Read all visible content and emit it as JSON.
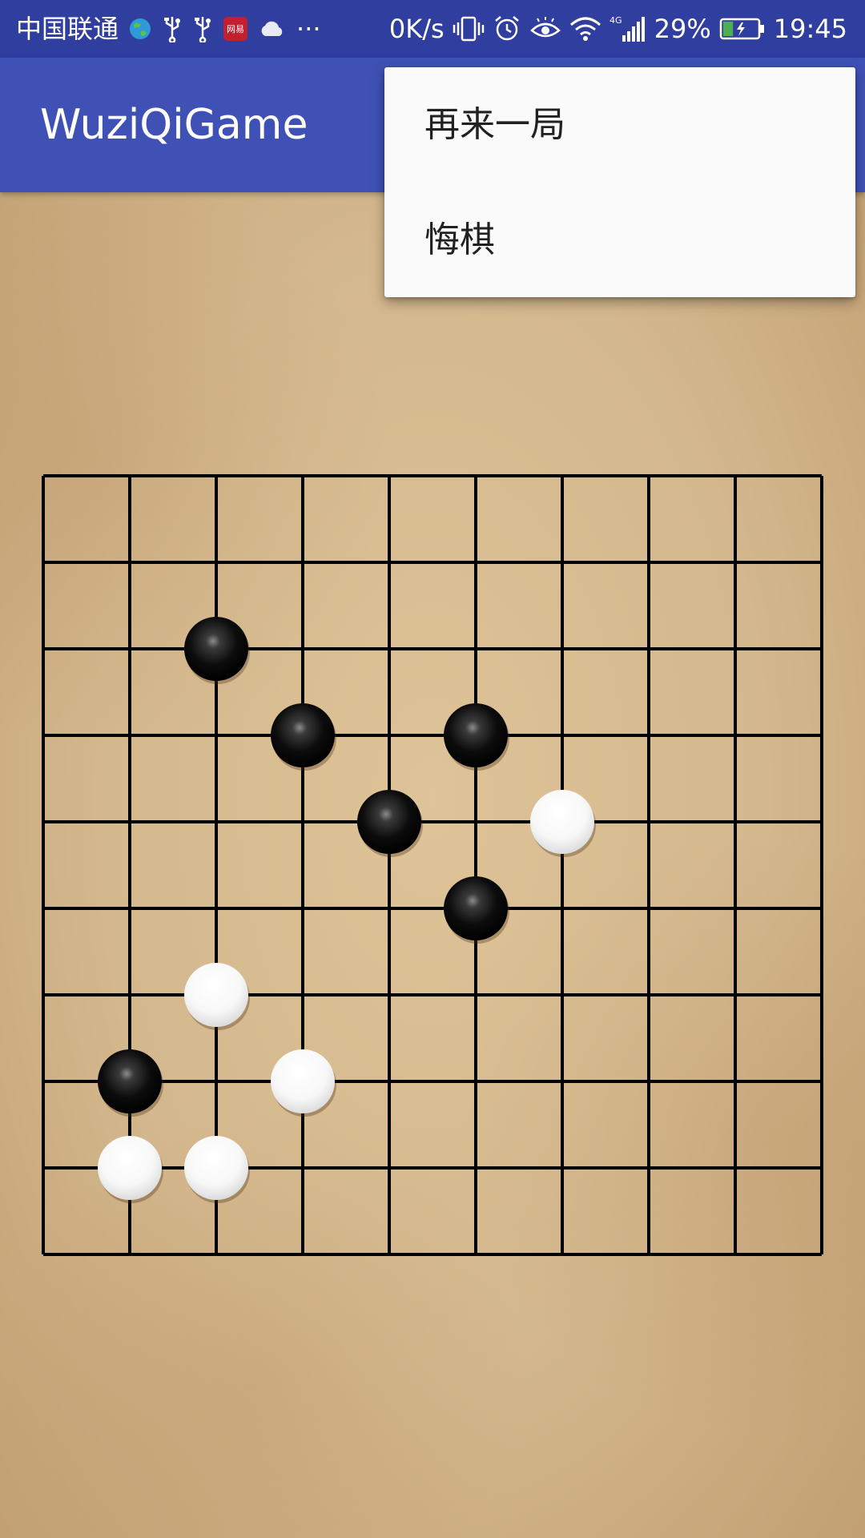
{
  "status_bar": {
    "carrier": "中国联通",
    "net_speed": "0K/s",
    "network_type": "4G",
    "battery_percent": "29%",
    "battery_level": 0.29,
    "time": "19:45",
    "more_dots": "···",
    "netease_badge": "网易",
    "icons_left": [
      "earth-icon",
      "usb-icon",
      "usb-icon",
      "netease-app-icon",
      "cloud-icon",
      "more-dots-icon"
    ],
    "icons_right": [
      "vibrate-icon",
      "alarm-icon",
      "eye-comfort-icon",
      "wifi-icon",
      "signal-icon",
      "battery-charging-icon"
    ]
  },
  "app_bar": {
    "title": "WuziQiGame"
  },
  "menu": {
    "items": [
      {
        "label": "再来一局"
      },
      {
        "label": "悔棋"
      }
    ]
  },
  "board": {
    "size": 10,
    "line_color": "#000000",
    "black_stones": [
      [
        2,
        2
      ],
      [
        3,
        3
      ],
      [
        5,
        3
      ],
      [
        4,
        4
      ],
      [
        5,
        5
      ],
      [
        1,
        7
      ]
    ],
    "white_stones": [
      [
        6,
        4
      ],
      [
        2,
        6
      ],
      [
        3,
        7
      ],
      [
        1,
        8
      ],
      [
        2,
        8
      ]
    ]
  },
  "colors": {
    "status_bar": "#303f9f",
    "app_bar": "#3f51b5",
    "menu_bg": "#fafafa",
    "menu_text": "#212121",
    "paper": "#d4b88e"
  }
}
